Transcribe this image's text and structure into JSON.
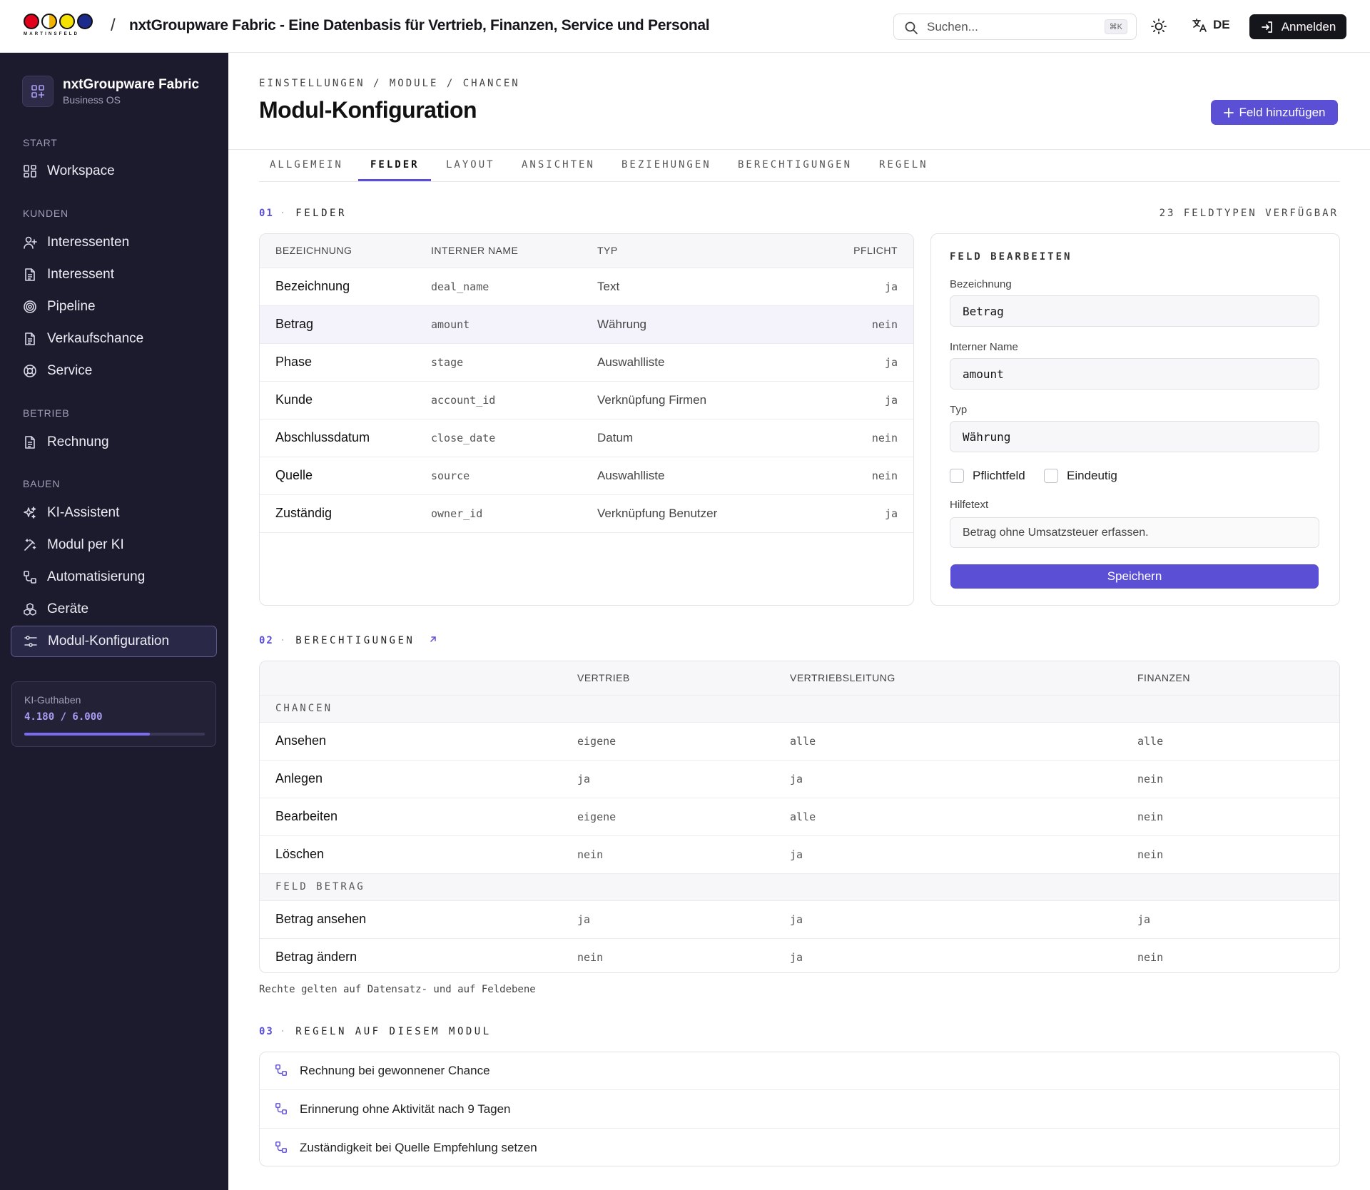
{
  "topbar": {
    "logo_text": "MARTINSFELD",
    "separator": "/",
    "app_title": "nxtGroupware Fabric - Eine Datenbasis für Vertrieb, Finanzen, Service und Personal",
    "search_placeholder": "Suchen...",
    "search_shortcut": "⌘K",
    "language": "DE",
    "login_label": "Anmelden"
  },
  "sidebar": {
    "brand_name": "nxtGroupware Fabric",
    "brand_sub": "Business OS",
    "sections": {
      "start": "START",
      "kunden": "KUNDEN",
      "betrieb": "BETRIEB",
      "bauen": "BAUEN"
    },
    "items": {
      "workspace": "Workspace",
      "interessenten": "Interessenten",
      "interessent": "Interessent",
      "pipeline": "Pipeline",
      "verkaufschance": "Verkaufschance",
      "service": "Service",
      "rechnung": "Rechnung",
      "ki_assistent": "KI-Assistent",
      "modul_ki": "Modul per KI",
      "automatisierung": "Automatisierung",
      "geraete": "Geräte",
      "modul_konfiguration": "Modul-Konfiguration"
    },
    "credit": {
      "label": "KI-Guthaben",
      "value": "4.180 / 6.000",
      "fraction": 0.697
    }
  },
  "main": {
    "breadcrumb": "EINSTELLUNGEN / MODULE / CHANCEN",
    "title": "Modul-Konfiguration",
    "add_field": "Feld hinzufügen",
    "tabs": [
      "ALLGEMEIN",
      "FELDER",
      "LAYOUT",
      "ANSICHTEN",
      "BEZIEHUNGEN",
      "BERECHTIGUNGEN",
      "REGELN"
    ],
    "active_tab": "FELDER"
  },
  "fields": {
    "num": "01",
    "title": "FELDER",
    "available": "23 FELDTYPEN VERFÜGBAR",
    "headers": [
      "BEZEICHNUNG",
      "INTERNER NAME",
      "TYP",
      "PFLICHT"
    ],
    "rows": [
      [
        "Bezeichnung",
        "deal_name",
        "Text",
        "ja"
      ],
      [
        "Betrag",
        "amount",
        "Währung",
        "nein"
      ],
      [
        "Phase",
        "stage",
        "Auswahlliste",
        "ja"
      ],
      [
        "Kunde",
        "account_id",
        "Verknüpfung Firmen",
        "ja"
      ],
      [
        "Abschlussdatum",
        "close_date",
        "Datum",
        "nein"
      ],
      [
        "Quelle",
        "source",
        "Auswahlliste",
        "nein"
      ],
      [
        "Zuständig",
        "owner_id",
        "Verknüpfung Benutzer",
        "ja"
      ]
    ]
  },
  "edit": {
    "title": "FELD BEARBEITEN",
    "label_bezeichnung": "Bezeichnung",
    "value_bezeichnung": "Betrag",
    "label_intern": "Interner Name",
    "value_intern": "amount",
    "label_typ": "Typ",
    "value_typ": "Währung",
    "pflichtfeld": "Pflichtfeld",
    "eindeutig": "Eindeutig",
    "label_hilfe": "Hilfetext",
    "value_hilfe": "Betrag ohne Umsatzsteuer erfassen.",
    "save": "Speichern"
  },
  "permissions": {
    "num": "02",
    "title": "BERECHTIGUNGEN",
    "headers": [
      "",
      "VERTRIEB",
      "VERTRIEBSLEITUNG",
      "FINANZEN"
    ],
    "group1": "CHANCEN",
    "rows1": [
      [
        "Ansehen",
        "eigene",
        "alle",
        "alle"
      ],
      [
        "Anlegen",
        "ja",
        "ja",
        "nein"
      ],
      [
        "Bearbeiten",
        "eigene",
        "alle",
        "nein"
      ],
      [
        "Löschen",
        "nein",
        "ja",
        "nein"
      ]
    ],
    "group2": "FELD BETRAG",
    "rows2": [
      [
        "Betrag ansehen",
        "ja",
        "ja",
        "ja"
      ],
      [
        "Betrag ändern",
        "nein",
        "ja",
        "nein"
      ]
    ],
    "note": "Rechte gelten auf Datensatz- und auf Feldebene"
  },
  "rules": {
    "num": "03",
    "title": "REGELN AUF DIESEM MODUL",
    "items": [
      "Rechnung bei gewonnener Chance",
      "Erinnerung ohne Aktivität nach 9 Tagen",
      "Zuständigkeit bei Quelle Empfehlung setzen"
    ]
  },
  "colors": {
    "accent": "#5b4fd6",
    "sidebar_bg": "#1c1b2e",
    "dark_button": "#15151c"
  }
}
